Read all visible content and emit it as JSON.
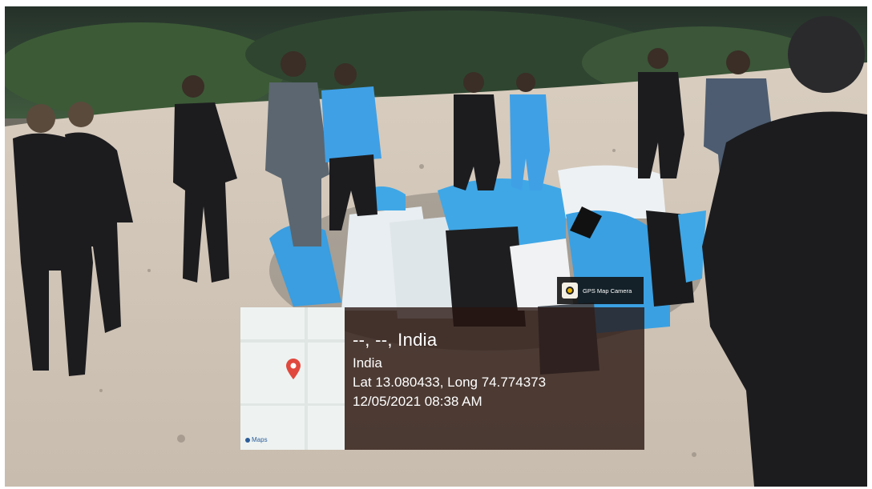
{
  "overlay": {
    "location_title": "--, --, India",
    "country": "India",
    "coordinates": "Lat 13.080433, Long 74.774373",
    "datetime": "12/05/2021 08:38 AM",
    "camera_label": "GPS Map Camera",
    "maps_label": "Maps"
  },
  "colors": {
    "overlay_bg": "#2a1410",
    "pin": "#e0483e",
    "bag_blue": "#3fa7e6"
  },
  "icons": {
    "map_pin": "map-pin-icon",
    "camera": "camera-icon",
    "maps_logo": "maps-logo-icon"
  }
}
